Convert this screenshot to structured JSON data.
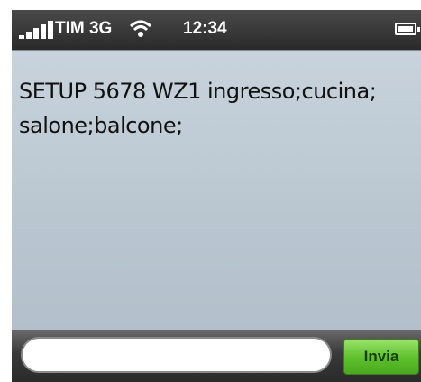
{
  "status_bar": {
    "carrier": "TIM 3G",
    "time": "12:34",
    "icons": [
      "signal-icon",
      "wifi-icon",
      "battery-icon"
    ]
  },
  "message": {
    "text": "SETUP 5678 WZ1 ingresso;cucina;\nsalone;balcone;"
  },
  "compose": {
    "input_value": "",
    "send_label": "Invia",
    "send_color": "#5cbf2a"
  }
}
